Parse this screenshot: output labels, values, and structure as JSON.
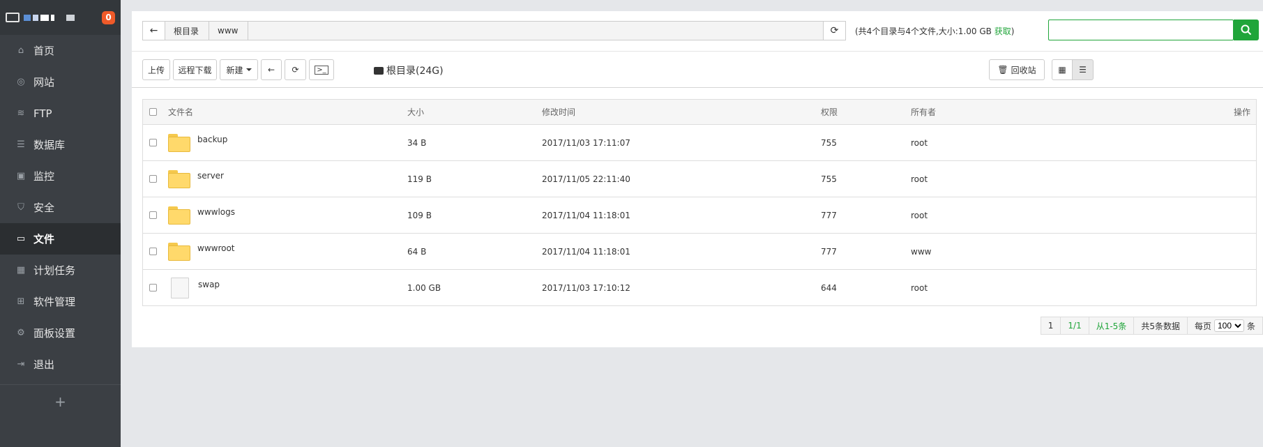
{
  "sidebar": {
    "badge": "0",
    "items": [
      {
        "label": "首页",
        "icon": "home-icon",
        "glyph": "⌂"
      },
      {
        "label": "网站",
        "icon": "globe-icon",
        "glyph": "◎"
      },
      {
        "label": "FTP",
        "icon": "ftp-icon",
        "glyph": "≋"
      },
      {
        "label": "数据库",
        "icon": "database-icon",
        "glyph": "☰"
      },
      {
        "label": "监控",
        "icon": "monitor-icon",
        "glyph": "▣"
      },
      {
        "label": "安全",
        "icon": "shield-icon",
        "glyph": "⛉"
      },
      {
        "label": "文件",
        "icon": "folder-icon",
        "glyph": "▭"
      },
      {
        "label": "计划任务",
        "icon": "calendar-icon",
        "glyph": "▦"
      },
      {
        "label": "软件管理",
        "icon": "apps-icon",
        "glyph": "⊞"
      },
      {
        "label": "面板设置",
        "icon": "gear-icon",
        "glyph": "⚙"
      },
      {
        "label": "退出",
        "icon": "logout-icon",
        "glyph": "⇥"
      }
    ],
    "active_index": 6,
    "add_label": "+"
  },
  "path": {
    "crumbs": [
      "根目录",
      "www"
    ],
    "summary_prefix": "(共4个目录与4个文件,大小:1.00 GB ",
    "summary_link": "获取",
    "summary_suffix": ")"
  },
  "toolbar": {
    "upload": "上传",
    "remote_download": "远程下载",
    "new": "新建",
    "disk_label": "根目录(24G)",
    "recycle": "回收站"
  },
  "table": {
    "headers": {
      "name": "文件名",
      "size": "大小",
      "time": "修改时间",
      "perm": "权限",
      "owner": "所有者",
      "op": "操作"
    },
    "rows": [
      {
        "name": "backup",
        "size": "34 B",
        "time": "2017/11/03 17:11:07",
        "perm": "755",
        "owner": "root",
        "type": "folder"
      },
      {
        "name": "server",
        "size": "119 B",
        "time": "2017/11/05 22:11:40",
        "perm": "755",
        "owner": "root",
        "type": "folder"
      },
      {
        "name": "wwwlogs",
        "size": "109 B",
        "time": "2017/11/04 11:18:01",
        "perm": "777",
        "owner": "root",
        "type": "folder"
      },
      {
        "name": "wwwroot",
        "size": "64 B",
        "time": "2017/11/04 11:18:01",
        "perm": "777",
        "owner": "www",
        "type": "folder"
      },
      {
        "name": "swap",
        "size": "1.00 GB",
        "time": "2017/11/03 17:10:12",
        "perm": "644",
        "owner": "root",
        "type": "file"
      }
    ]
  },
  "pager": {
    "page": "1",
    "pages": "1/1",
    "range": "从1-5条",
    "total": "共5条数据",
    "per_page_label": "每页",
    "per_page_value": "100",
    "unit": "条"
  },
  "colors": {
    "accent": "#20a53a",
    "sidebar_bg": "#3b3f44",
    "badge": "#ef5a29"
  }
}
